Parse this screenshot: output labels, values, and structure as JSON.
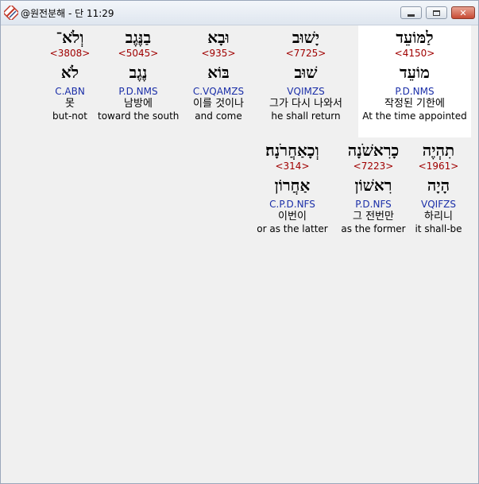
{
  "window": {
    "title": "@원전분해 - 단 11:29",
    "icon": "app-logo-icon",
    "controls": [
      "minimize-icon",
      "maximize-icon",
      "close-icon"
    ]
  },
  "colors": {
    "strong": "#a00000",
    "morph": "#1a2ea8",
    "selection_bg": "#ffffff"
  },
  "rows": [
    {
      "words": [
        {
          "hebrew": "לַמּוֹעֵד",
          "strong": "<4150>",
          "lemma": "מוֹעֵד",
          "morph": "P.D.NMS",
          "korean": "작정된 기한에",
          "english": "At the time appointed",
          "selected": true
        },
        {
          "hebrew": "יָשׁוּב",
          "strong": "<7725>",
          "lemma": "שׁוּב",
          "morph": "VQIMZS",
          "korean": "그가 다시 나와서",
          "english": "he shall return"
        },
        {
          "hebrew": "וּבָא",
          "strong": "<935>",
          "lemma": "בּוֹא",
          "morph": "C.VQAMZS",
          "korean": "이를 것이나",
          "english": "and come"
        },
        {
          "hebrew": "בַנֶּגֶב",
          "strong": "<5045>",
          "lemma": "נֶגֶב",
          "morph": "P.D.NMS",
          "korean": "남방에",
          "english": "toward the south"
        },
        {
          "hebrew": "וְלֹא־",
          "strong": "<3808>",
          "lemma": "לֹא",
          "morph": "C.ABN",
          "korean": "못",
          "english": "but-not"
        }
      ]
    },
    {
      "words": [
        {
          "hebrew": "תִהְיֶה",
          "strong": "<1961>",
          "lemma": "הָיָה",
          "morph": "VQIFZS",
          "korean": "하리니",
          "english": "it shall-be"
        },
        {
          "hebrew": "כָרִאשֹׁנָה",
          "strong": "<7223>",
          "lemma": "רִאשׁוֹן",
          "morph": "P.D.NFS",
          "korean": "그 전번만",
          "english": "as the former"
        },
        {
          "hebrew": "וְכָאַחֲרֹנָה׃",
          "strong": "<314>",
          "lemma": "אַחֲרוֹן",
          "morph": "C.P.D.NFS",
          "korean": "이번이",
          "english": "or as the latter"
        }
      ]
    }
  ]
}
